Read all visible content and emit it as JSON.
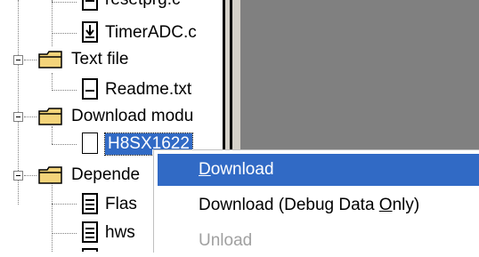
{
  "tree": {
    "items": [
      {
        "label": "resetprg.c"
      },
      {
        "label": "TimerADC.c"
      },
      {
        "label": "Text file"
      },
      {
        "label": "Readme.txt"
      },
      {
        "label": "Download modu"
      },
      {
        "label": "H8SX1622"
      },
      {
        "label": "Depende"
      },
      {
        "label": "Flas"
      },
      {
        "label": "hws"
      }
    ]
  },
  "context_menu": {
    "download": {
      "u": "D",
      "rest": "ownload"
    },
    "download_debug": {
      "pre": "Download (Debug Data ",
      "u": "O",
      "rest": "nly)"
    },
    "unload": {
      "label": "Unload"
    }
  },
  "colors": {
    "selection": "#316ac5",
    "panel_grey": "#808080",
    "splitter": "#d4d0c8"
  }
}
